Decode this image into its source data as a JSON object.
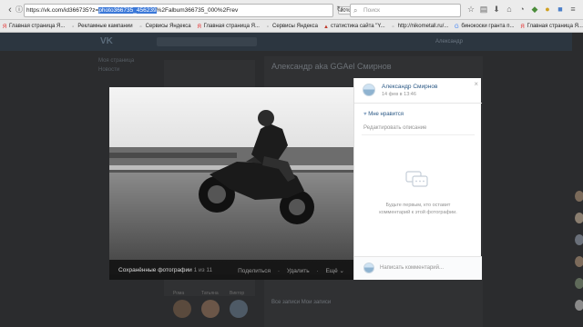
{
  "browser": {
    "url_prefix": "https://vk.com/id366735?z=",
    "url_selected": "photo366735_456239",
    "url_suffix": "%2Falbum366735_000%2Frev",
    "zoom": "90%",
    "search_placeholder": "Поиск",
    "bookmarks": [
      {
        "label": "Главная страница Я...",
        "icon": "yandex-icon",
        "color": "#e52b2b"
      },
      {
        "label": "Рекламные кампании",
        "icon": "page-icon",
        "color": "#888"
      },
      {
        "label": "Сервисы Яндекса",
        "icon": "page-icon",
        "color": "#888"
      },
      {
        "label": "Главная страница Я...",
        "icon": "yandex-icon",
        "color": "#e52b2b"
      },
      {
        "label": "Сервисы Яндекса",
        "icon": "page-icon",
        "color": "#888"
      },
      {
        "label": "статистика сайта \"Y...",
        "icon": "chart-icon",
        "color": "#c0392b"
      },
      {
        "label": "http://nikometall.ru/...",
        "icon": "page-icon",
        "color": "#888"
      },
      {
        "label": "бинокоски гранта п...",
        "icon": "google-icon",
        "color": "#4285f4"
      },
      {
        "label": "Главная страница Я...",
        "icon": "yandex-icon",
        "color": "#e52b2b"
      }
    ]
  },
  "page": {
    "logo": "VK",
    "user_label": "Александр",
    "profile_name": "Александр aka GGAel Смирнов",
    "sidebar": [
      "Моя страница",
      "Новости"
    ],
    "friends": [
      "Рома",
      "Татьяна",
      "Виктор"
    ],
    "wall_tabs": "Все записи    Мои записи"
  },
  "viewer": {
    "album": "Сохранённые фотографии",
    "count": "1 из 11",
    "actions": [
      "Поделиться",
      "Удалить",
      "Ещё ⌄"
    ],
    "author_name": "Александр Смирнов",
    "date": "14 фев в 13:46",
    "close": "×",
    "like": "Мне нравится",
    "edit": "Редактировать описание",
    "empty_comments": "Будьте первым, кто оставит комментарий к этой фотографии.",
    "comment_placeholder": "Написать комментарий..."
  },
  "colors": {
    "link": "#2a5885",
    "muted": "#939393",
    "selection": "#3b78d8"
  }
}
